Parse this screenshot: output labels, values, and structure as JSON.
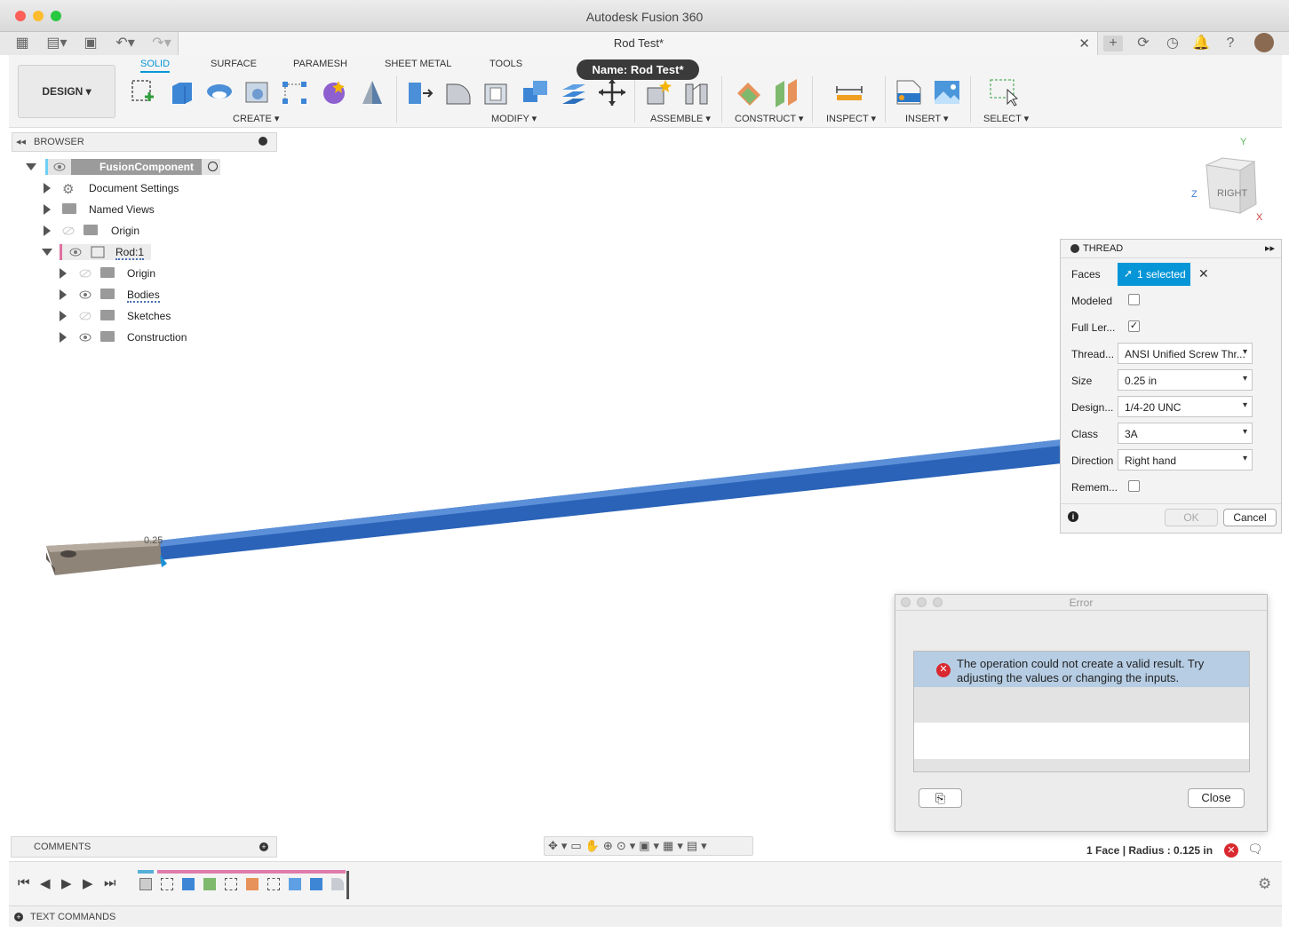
{
  "window": {
    "title": "Autodesk Fusion 360",
    "document_tab": "Rod Test*",
    "tooltip": "Name: Rod Test*"
  },
  "workspace": {
    "label": "DESIGN ▾"
  },
  "ribbon_tabs": [
    "SOLID",
    "SURFACE",
    "PARAMESH",
    "SHEET METAL",
    "TOOLS"
  ],
  "groups": {
    "create": "CREATE ▾",
    "modify": "MODIFY ▾",
    "assemble": "ASSEMBLE ▾",
    "construct": "CONSTRUCT ▾",
    "inspect": "INSPECT ▾",
    "insert": "INSERT ▾",
    "select": "SELECT ▾"
  },
  "browser": {
    "title": "BROWSER",
    "root": "FusionComponent",
    "items": [
      "Document Settings",
      "Named Views",
      "Origin",
      "Rod:1"
    ],
    "children": [
      "Origin",
      "Bodies",
      "Sketches",
      "Construction"
    ]
  },
  "viewcube": {
    "face": "RIGHT",
    "x": "X",
    "y": "Y",
    "z": "Z"
  },
  "thread_panel": {
    "title": "THREAD",
    "faces_label": "Faces",
    "faces_value": "1 selected",
    "modeled_label": "Modeled",
    "full_length_label": "Full Ler...",
    "thread_type_label": "Thread...",
    "thread_type_value": "ANSI Unified Screw Thr...",
    "size_label": "Size",
    "size_value": "0.25 in",
    "designation_label": "Design...",
    "designation_value": "1/4-20 UNC",
    "class_label": "Class",
    "class_value": "3A",
    "direction_label": "Direction",
    "direction_value": "Right hand",
    "remember_label": "Remem...",
    "ok": "OK",
    "cancel": "Cancel",
    "modeled_checked": false,
    "full_length_checked": true,
    "remember_checked": false
  },
  "error_dialog": {
    "title": "Error",
    "message": "The operation could not create a valid result. Try adjusting the values or changing the inputs.",
    "close": "Close"
  },
  "model": {
    "dimension_label": "0.25"
  },
  "comments": {
    "title": "COMMENTS"
  },
  "status": {
    "selection": "1 Face | Radius : 0.125 in"
  },
  "text_commands": {
    "title": "TEXT COMMANDS"
  },
  "colors": {
    "accent": "#0696d7",
    "rod": "#2a63b8",
    "error": "#d9282f"
  }
}
